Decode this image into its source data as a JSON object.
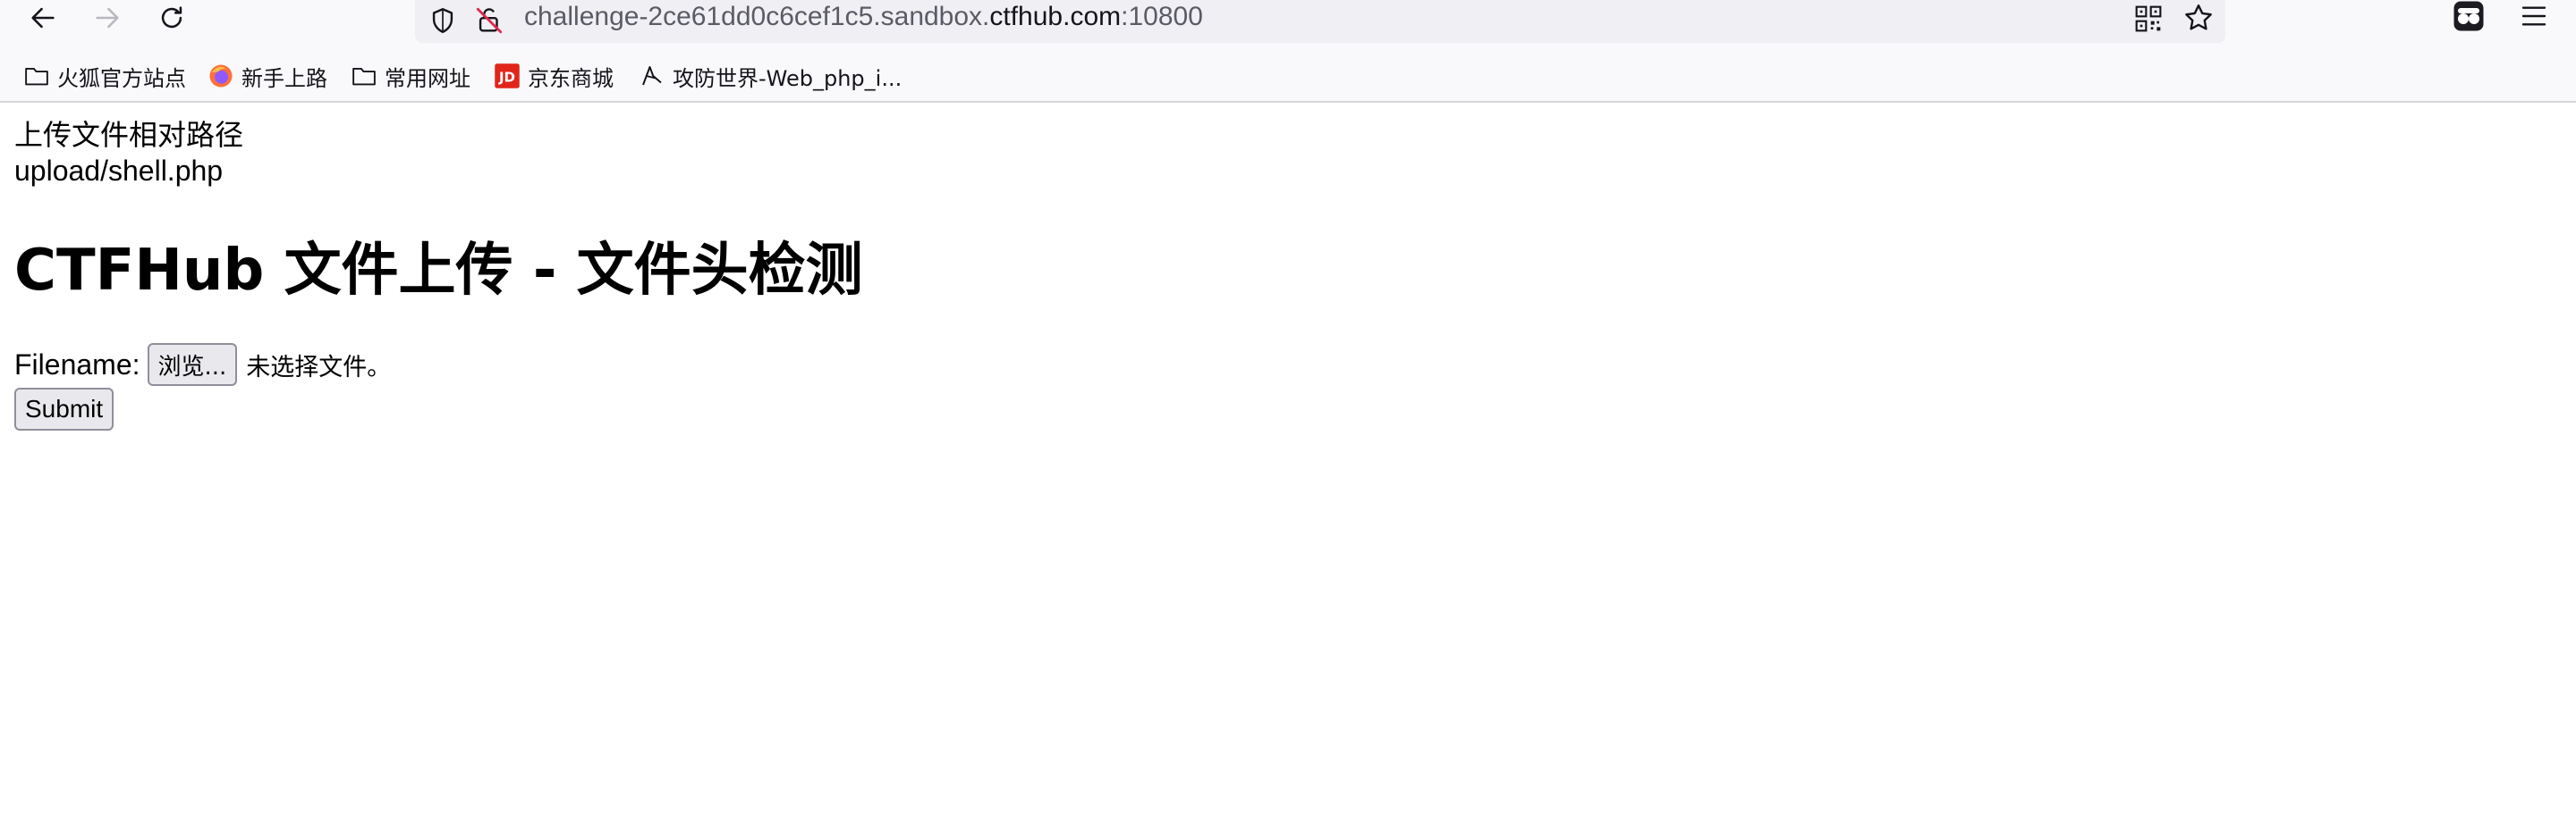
{
  "browser": {
    "url_prefix": "challenge-2ce61dd0c6cef1c5.sandbox.",
    "url_host": "ctfhub.com",
    "url_port": ":10800",
    "bookmarks": [
      {
        "label": "火狐官方站点",
        "icon": "folder-icon"
      },
      {
        "label": "新手上路",
        "icon": "firefox-icon"
      },
      {
        "label": "常用网址",
        "icon": "folder-icon"
      },
      {
        "label": "京东商城",
        "icon": "jd-icon"
      },
      {
        "label": "攻防世界-Web_php_i...",
        "icon": "adworld-icon"
      }
    ],
    "colors": {
      "chrome_bg": "#f9f9fb",
      "urlbar_bg": "#f0f0f4",
      "jd_red": "#e1251b"
    }
  },
  "page": {
    "upload_label": "上传文件相对路径",
    "upload_path": "upload/shell.php",
    "title": "CTFHub 文件上传 - 文件头检测",
    "filename_label": "Filename:",
    "browse_label": "浏览...",
    "no_file_text": "未选择文件。",
    "submit_label": "Submit"
  }
}
